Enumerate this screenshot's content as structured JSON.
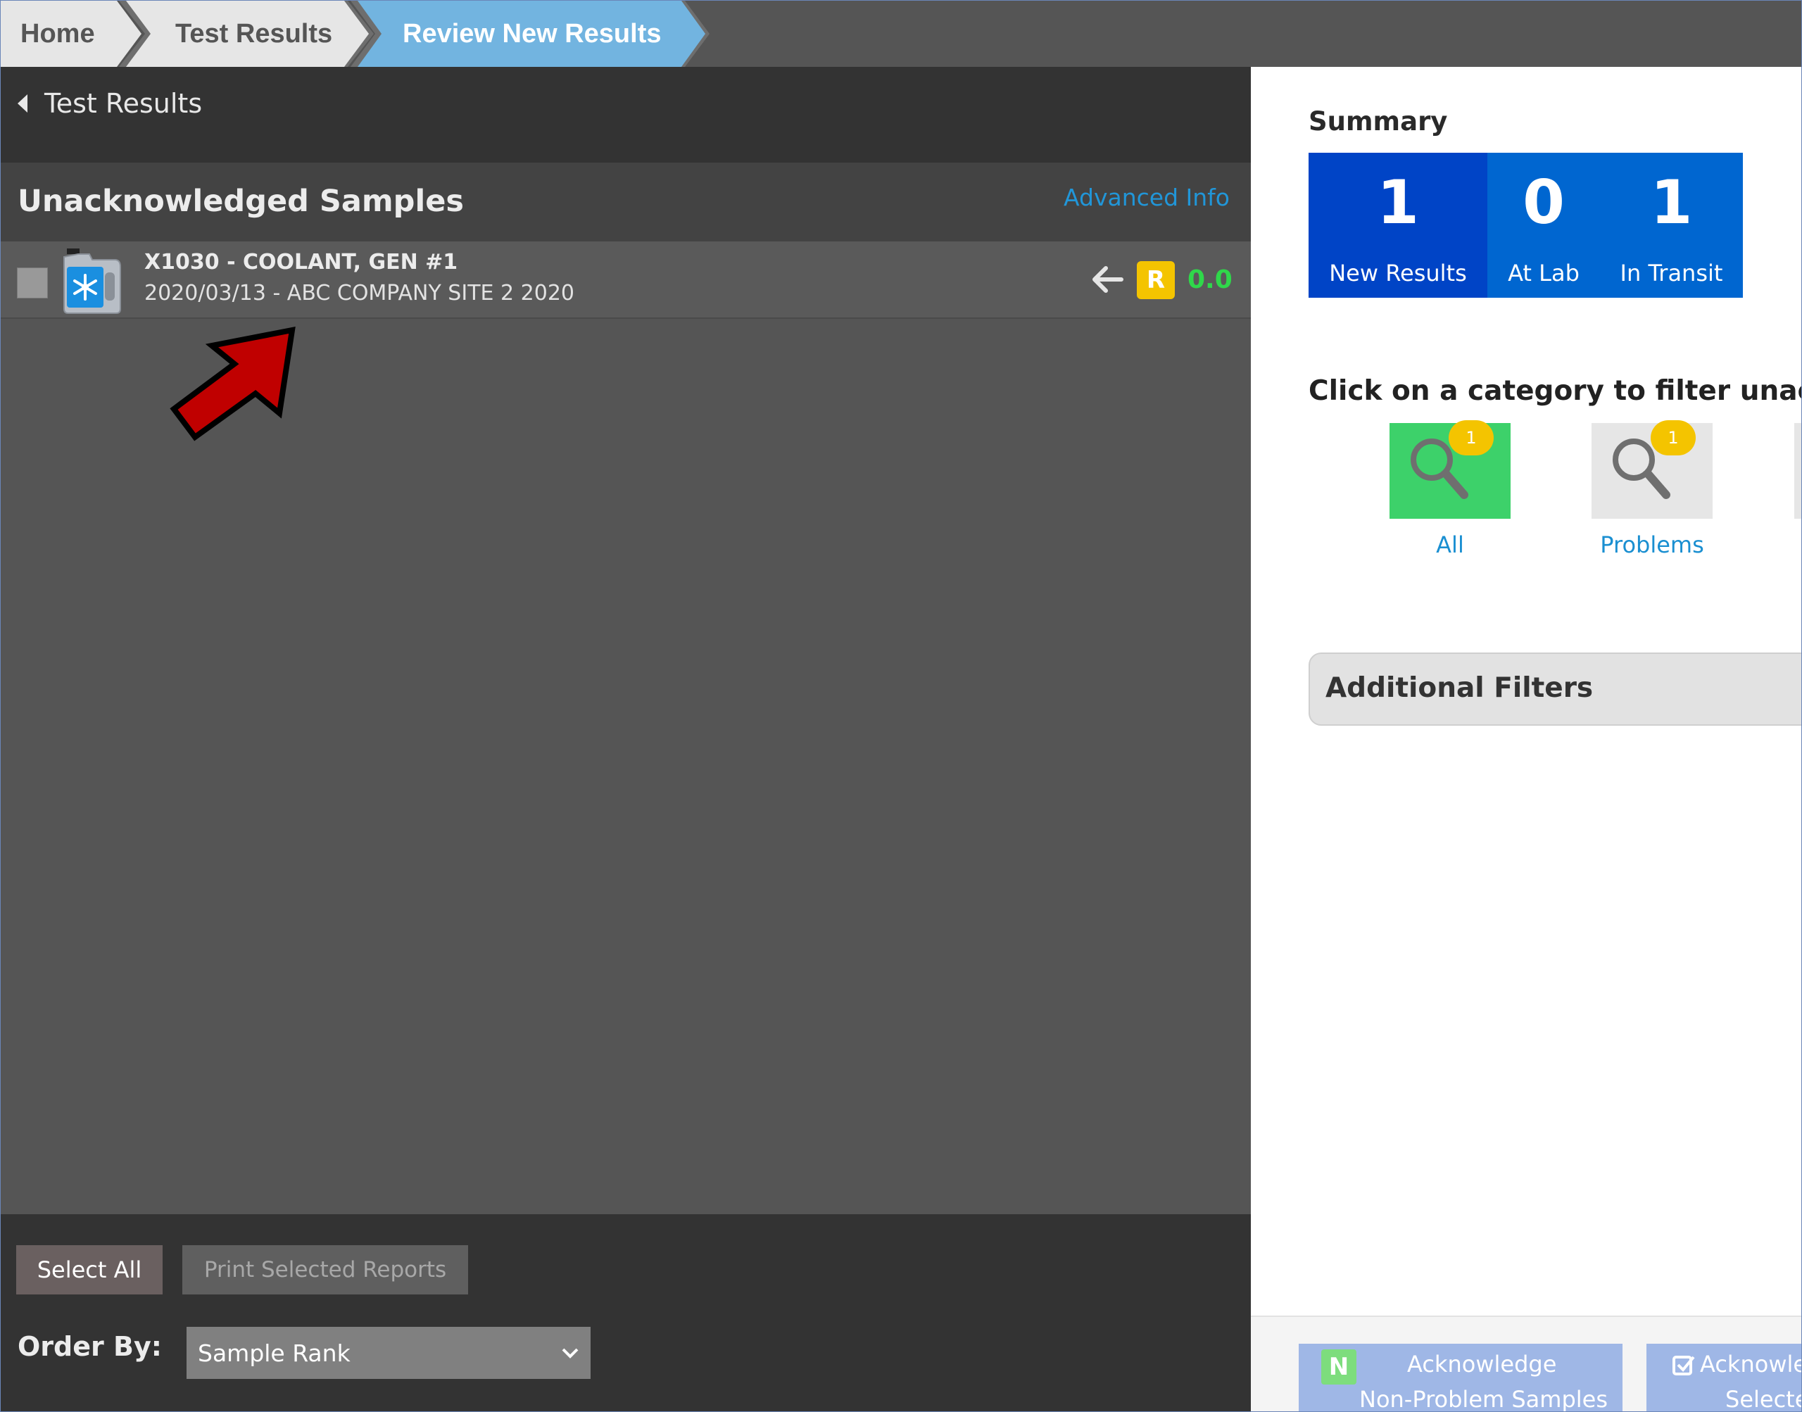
{
  "breadcrumb": [
    {
      "label": "Home"
    },
    {
      "label": "Test Results"
    },
    {
      "label": "Review New Results"
    }
  ],
  "left_panel": {
    "back_link": "Test Results",
    "title": "Unacknowledged Samples",
    "advanced_info": "Advanced Info",
    "samples": [
      {
        "line1": "X1030 - COOLANT, GEN #1",
        "line2": "2020/03/13 - ABC COMPANY SITE 2 2020",
        "rank_badge": "R",
        "score": "0.0",
        "icon": "coolant-jug-icon"
      }
    ],
    "buttons": {
      "select_all": "Select All",
      "print_selected": "Print Selected Reports"
    },
    "order_by": {
      "label": "Order By:",
      "selected": "Sample Rank"
    }
  },
  "right_panel": {
    "summary": {
      "title": "Summary",
      "items": [
        {
          "count": "1",
          "label": "New Results"
        },
        {
          "count": "0",
          "label": "At Lab"
        },
        {
          "count": "1",
          "label": "In Transit"
        }
      ]
    },
    "filter_prompt": "Click on a category to filter unacknow",
    "categories": [
      {
        "label": "All",
        "count": "1"
      },
      {
        "label": "Problems",
        "count": "1"
      }
    ],
    "additional_filters": "Additional Filters",
    "bottom_buttons": {
      "nonproblem_badge": "N",
      "nonproblem_line1": "Acknowledge",
      "nonproblem_line2": "Non-Problem Samples",
      "selected_line1": "Acknowle",
      "selected_line2": "Selecte"
    }
  },
  "colors": {
    "accent_blue": "#0044c6",
    "summary_blue": "#0066d0",
    "crumb_active": "#72b4e0",
    "score_green": "#2fd84a",
    "badge_yellow": "#f4c400",
    "all_tile_green": "#3dd16a",
    "pointer_red": "#c00000"
  }
}
